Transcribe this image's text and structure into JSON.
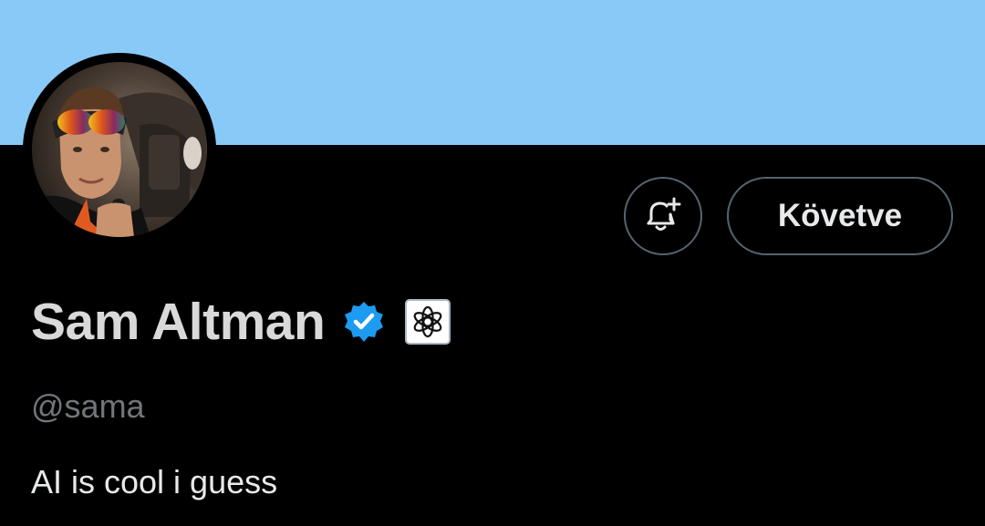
{
  "profile": {
    "display_name": "Sam Altman",
    "handle": "@sama",
    "bio": "AI is cool i guess",
    "verified_icon": "verified-checkmark-icon",
    "affiliation_icon": "openai-logo-icon"
  },
  "actions": {
    "notify_icon": "bell-plus-icon",
    "follow_label": "Követve"
  },
  "colors": {
    "banner": "#89C9F8",
    "background": "#000000",
    "verified": "#1D9BF0",
    "name_text": "#D9D9D9",
    "handle_text": "#71767B",
    "button_border": "#536471"
  }
}
